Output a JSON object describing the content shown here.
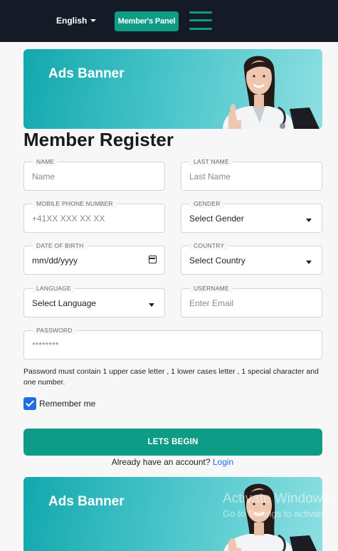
{
  "header": {
    "language": "English",
    "members_panel": "Member's Panel"
  },
  "banner": {
    "text": "Ads Banner"
  },
  "form": {
    "title": "Member Register",
    "fields": {
      "name": {
        "label": "NAME",
        "placeholder": "Name"
      },
      "last_name": {
        "label": "LAST NAME",
        "placeholder": "Last Name"
      },
      "mobile": {
        "label": "MOBILE PHONE NUMBER",
        "placeholder": "+41XX XXX XX XX"
      },
      "gender": {
        "label": "GENDER",
        "value": "Select Gender"
      },
      "dob": {
        "label": "DATE OF BIRTH",
        "value": "mm/dd/yyyy"
      },
      "country": {
        "label": "COUNTRY",
        "value": "Select Country"
      },
      "language": {
        "label": "LANGUAGE",
        "value": "Select Language"
      },
      "username": {
        "label": "USERNAME",
        "placeholder": "Enter Email"
      },
      "password": {
        "label": "PASSWORD",
        "value": "********"
      }
    },
    "password_hint": "Password must contain 1 upper case letter , 1 lower cases letter , 1 special character and one number.",
    "remember_me": {
      "label": "Remember me",
      "checked": true
    },
    "submit": "LETS BEGIN",
    "login_prompt": "Already have an account?",
    "login_link": "Login"
  },
  "watermark": {
    "line1": "Activate Windows",
    "line2": "Go to Settings to activate"
  },
  "colors": {
    "header_bg": "#141b27",
    "accent": "#0e9c86",
    "link": "#1d6fe0",
    "banner": "#12a8ad"
  }
}
